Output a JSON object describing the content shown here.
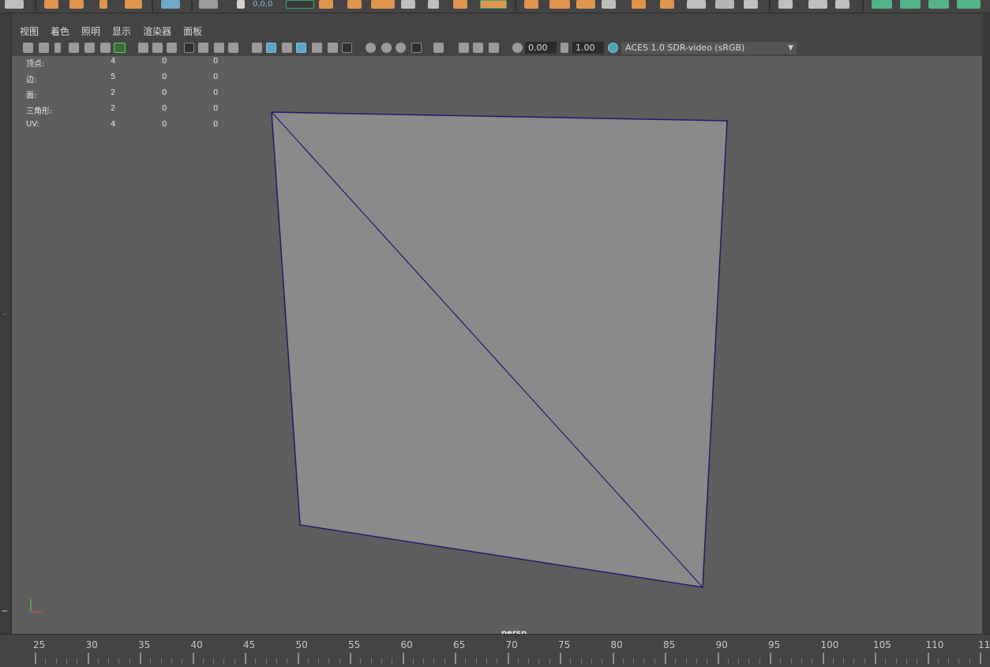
{
  "shelf": {
    "coords_readout": "0,0,0"
  },
  "menubar": {
    "items": [
      {
        "label": "视图"
      },
      {
        "label": "着色"
      },
      {
        "label": "照明"
      },
      {
        "label": "显示"
      },
      {
        "label": "渲染器"
      },
      {
        "label": "面板"
      }
    ]
  },
  "iconbar": {
    "field_a": "0.00",
    "field_b": "1.00",
    "color_management": "ACES 1.0 SDR-video (sRGB)"
  },
  "hud": {
    "rows": [
      {
        "label": "顶点:",
        "v1": "4",
        "v2": "0",
        "v3": "0"
      },
      {
        "label": "边:",
        "v1": "5",
        "v2": "0",
        "v3": "0"
      },
      {
        "label": "面:",
        "v1": "2",
        "v2": "0",
        "v3": "0"
      },
      {
        "label": "三角形:",
        "v1": "2",
        "v2": "0",
        "v3": "0"
      },
      {
        "label": "UV:",
        "v1": "4",
        "v2": "0",
        "v3": "0"
      }
    ]
  },
  "viewport": {
    "camera": "persp",
    "edge_color": "#1c1c6a",
    "face_color": "#8a8a8a"
  },
  "timeline": {
    "labels": [
      "25",
      "30",
      "35",
      "40",
      "45",
      "50",
      "55",
      "60",
      "65",
      "70",
      "75",
      "80",
      "85",
      "90",
      "95",
      "100",
      "105",
      "110",
      "11"
    ]
  },
  "icons": [
    "move-tool-icon",
    "rotate-tool-icon",
    "scale-tool-icon",
    "camera-icon",
    "wireframe-icon",
    "smooth-shade-icon",
    "light-icon",
    "grid-icon",
    "color-management-icon",
    "axis-gizmo-icon"
  ]
}
